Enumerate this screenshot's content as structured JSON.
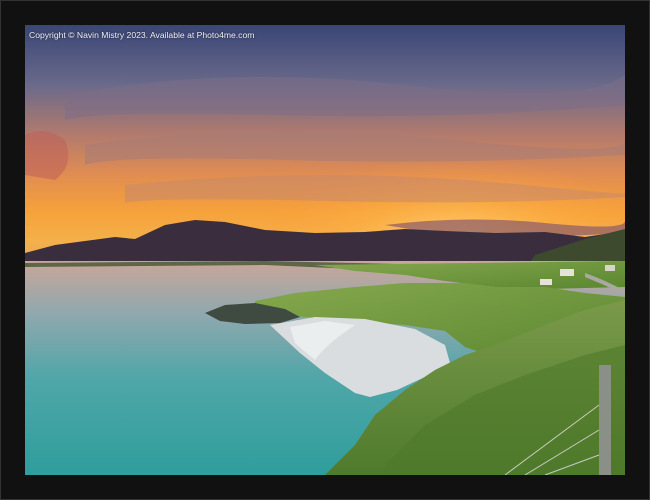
{
  "watermark": {
    "text": "Copyright © Navin Mistry 2023. Available at Photo4me.com"
  },
  "colors": {
    "frame": "#111111",
    "sky_top": "#3c4a78",
    "sky_mid": "#c97a5a",
    "sky_glow": "#f7a33a",
    "sea": "#3fa8a4",
    "grass": "#6f9a3a",
    "sand": "#d9dde0"
  }
}
